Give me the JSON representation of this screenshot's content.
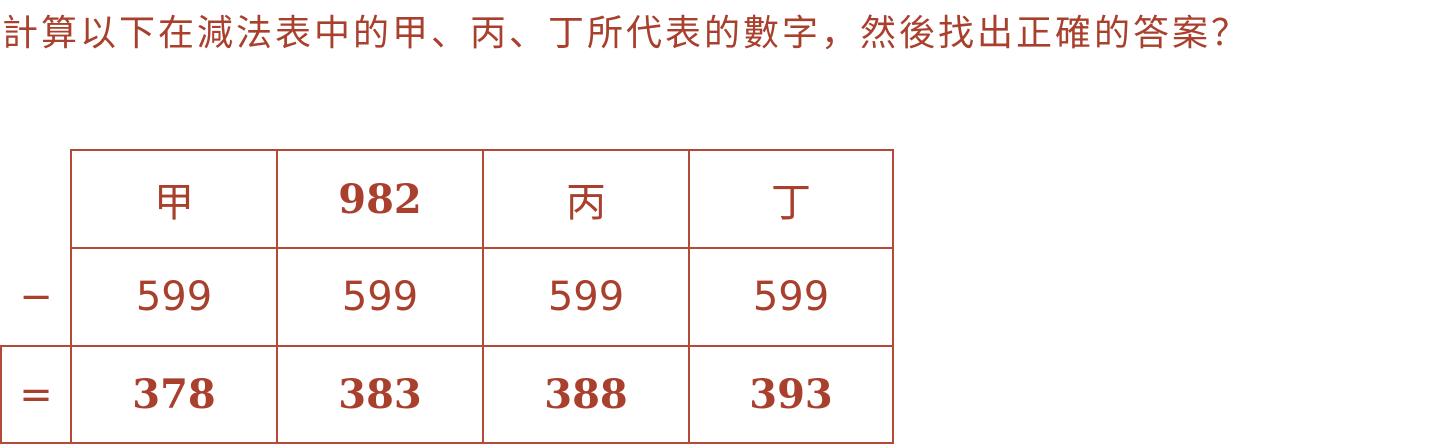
{
  "question": {
    "text": "計算以下在減法表中的甲、丙、丁所代表的數字，然後找出正確的答案？"
  },
  "table": {
    "operators": {
      "minus": "−",
      "equals": "="
    },
    "headers": [
      "甲",
      "982",
      "丙",
      "丁"
    ],
    "subtrahends": [
      "599",
      "599",
      "599",
      "599"
    ],
    "results": [
      "378",
      "383",
      "388",
      "393"
    ]
  },
  "colors": {
    "text": "#a9402d",
    "border": "#b34a37"
  }
}
